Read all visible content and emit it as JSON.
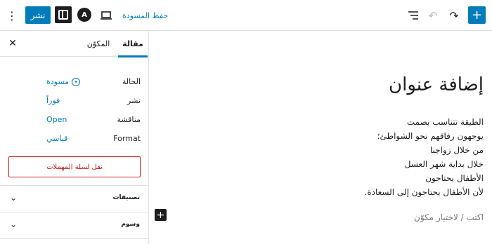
{
  "toolbar": {
    "publish_label": "نشر",
    "save_draft_label": "حفظ المسودة",
    "brand_glyph": "A",
    "inserter_glyph": "+",
    "undo_glyph": "↶",
    "redo_glyph": "↷",
    "kebab_glyph": "⋮",
    "accent_color": "#007cba"
  },
  "sidebar": {
    "close_glyph": "✕",
    "tabs": [
      {
        "label": "مقالة",
        "active": true
      },
      {
        "label": "المكوّن",
        "active": false
      }
    ],
    "summary": {
      "rows": [
        {
          "label": "الحالة",
          "value": "مسودة",
          "icon": "status-draft-icon"
        },
        {
          "label": "نشر",
          "value": "فوراً"
        },
        {
          "label": "مناقشة",
          "value": "Open"
        },
        {
          "label": "Format",
          "value": "قياسي"
        }
      ],
      "trash_label": "نقل لسلة المهملات"
    },
    "panels": [
      {
        "title": "تصنيفات",
        "chevron": "⌄"
      },
      {
        "title": "وسوم",
        "chevron": "⌄"
      }
    ]
  },
  "editor": {
    "title": "إضافة عنوان",
    "poem_lines": [
      "الطيقة تتناسب بصمت",
      "يوجهون رفاقهم نحو الشواطئ؛",
      "من خلال زواجنا",
      "خلال بداية شهر العسل",
      "الأطفال يحتاجون",
      "لأن الأطفال يحتاجون إلى السعادة."
    ],
    "placeholder": "اكتب / لاختيار مكوّن",
    "add_block_glyph": "+"
  }
}
